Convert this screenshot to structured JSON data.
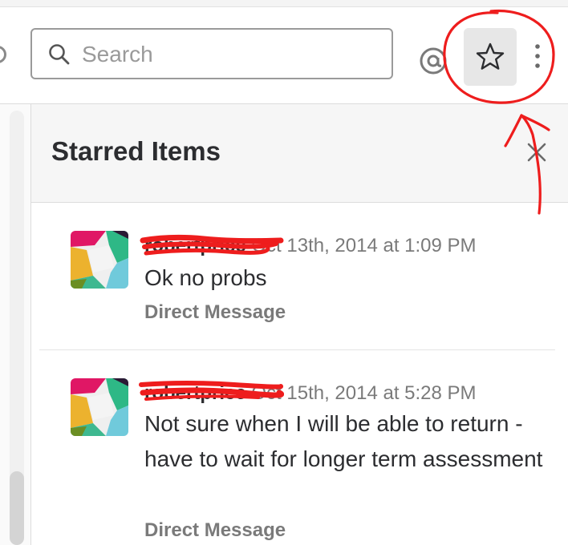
{
  "search": {
    "placeholder": "Search"
  },
  "toolbar": {
    "mention_icon": "at-sign-icon",
    "star_icon": "star-icon",
    "more_icon": "vertical-ellipsis-icon",
    "star_active_bg": "#e7e7e7"
  },
  "panel": {
    "title": "Starred Items",
    "close_icon": "close-icon"
  },
  "items": [
    {
      "sender": "robertprice",
      "timestamp": "Oct 13th, 2014 at 1:09 PM",
      "message": "Ok no probs",
      "source": "Direct Message"
    },
    {
      "sender": "robertprice",
      "timestamp": "Oct 15th, 2014 at 5:28 PM",
      "message": "Not sure when I will be able to return - have to wait for longer term assessment",
      "source": "Direct Message"
    }
  ],
  "annotation": {
    "color": "#ee1d1d"
  }
}
